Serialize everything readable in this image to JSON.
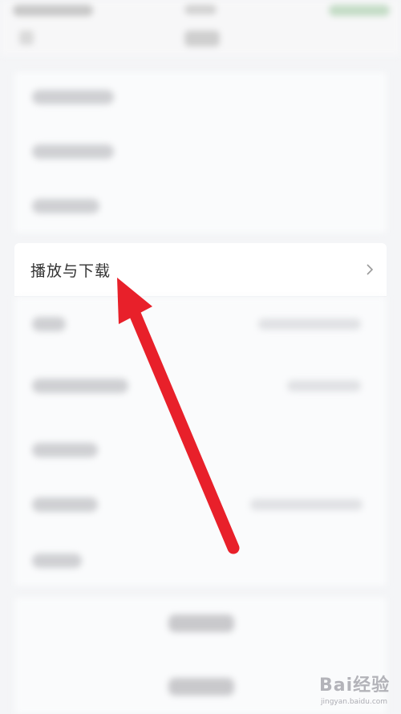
{
  "settings": {
    "focused_item_label": "播放与下载"
  },
  "colors": {
    "arrow": "#e8202a",
    "page_background": "#f4f5f7",
    "card_background": "#ffffff"
  },
  "icons": {
    "chevron": "chevron-right-icon"
  },
  "watermark": {
    "brand": "Bai经验",
    "url": "jingyan.baidu.com"
  }
}
